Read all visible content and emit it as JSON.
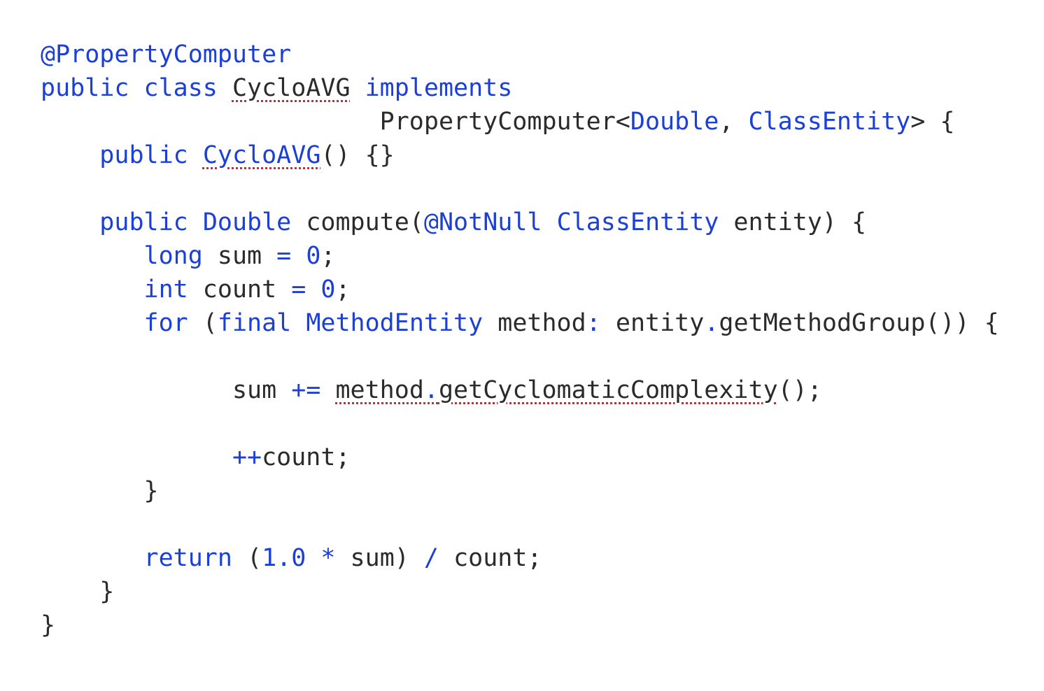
{
  "editor": {
    "colors": {
      "keyword": "#1c3fd6",
      "text": "#2b2b2b",
      "error_underline": "#e0202a",
      "background": "#ffffff"
    },
    "lines": [
      {
        "indent": 0,
        "tokens": [
          {
            "t": "@PropertyComputer",
            "c": "ann"
          }
        ]
      },
      {
        "indent": 0,
        "tokens": [
          {
            "t": "public",
            "c": "kw"
          },
          {
            "t": " ",
            "c": "plain"
          },
          {
            "t": "class",
            "c": "kw"
          },
          {
            "t": " ",
            "c": "plain"
          },
          {
            "t": "CycloAVG",
            "c": "plain",
            "err": true
          },
          {
            "t": " ",
            "c": "plain"
          },
          {
            "t": "implements",
            "c": "kw"
          }
        ]
      },
      {
        "indent": 0,
        "tokens": [
          {
            "t": "                       PropertyComputer<",
            "c": "plain"
          },
          {
            "t": "Double",
            "c": "ty"
          },
          {
            "t": ", ",
            "c": "plain"
          },
          {
            "t": "ClassEntity",
            "c": "ty"
          },
          {
            "t": "> {",
            "c": "plain"
          }
        ]
      },
      {
        "indent": 0,
        "tokens": [
          {
            "t": "    ",
            "c": "plain"
          },
          {
            "t": "public",
            "c": "kw"
          },
          {
            "t": " ",
            "c": "plain"
          },
          {
            "t": "CycloAVG",
            "c": "ty",
            "err": true
          },
          {
            "t": "() {}",
            "c": "plain"
          }
        ]
      },
      {
        "indent": 0,
        "tokens": []
      },
      {
        "indent": 0,
        "tokens": [
          {
            "t": "    ",
            "c": "plain"
          },
          {
            "t": "public",
            "c": "kw"
          },
          {
            "t": " ",
            "c": "plain"
          },
          {
            "t": "Double",
            "c": "ty"
          },
          {
            "t": " compute(",
            "c": "plain"
          },
          {
            "t": "@NotNull",
            "c": "ann"
          },
          {
            "t": " ",
            "c": "plain"
          },
          {
            "t": "ClassEntity",
            "c": "ty"
          },
          {
            "t": " entity) {",
            "c": "plain"
          }
        ]
      },
      {
        "indent": 0,
        "tokens": [
          {
            "t": "       ",
            "c": "plain"
          },
          {
            "t": "long",
            "c": "kw"
          },
          {
            "t": " sum ",
            "c": "plain"
          },
          {
            "t": "=",
            "c": "op"
          },
          {
            "t": " ",
            "c": "plain"
          },
          {
            "t": "0",
            "c": "num"
          },
          {
            "t": ";",
            "c": "plain"
          }
        ]
      },
      {
        "indent": 0,
        "tokens": [
          {
            "t": "       ",
            "c": "plain"
          },
          {
            "t": "int",
            "c": "kw"
          },
          {
            "t": " count ",
            "c": "plain"
          },
          {
            "t": "=",
            "c": "op"
          },
          {
            "t": " ",
            "c": "plain"
          },
          {
            "t": "0",
            "c": "num"
          },
          {
            "t": ";",
            "c": "plain"
          }
        ]
      },
      {
        "indent": 0,
        "tokens": [
          {
            "t": "       ",
            "c": "plain"
          },
          {
            "t": "for",
            "c": "kw"
          },
          {
            "t": " (",
            "c": "plain"
          },
          {
            "t": "final",
            "c": "kw"
          },
          {
            "t": " ",
            "c": "plain"
          },
          {
            "t": "MethodEntity",
            "c": "ty"
          },
          {
            "t": " method",
            "c": "plain"
          },
          {
            "t": ":",
            "c": "op"
          },
          {
            "t": " entity",
            "c": "plain"
          },
          {
            "t": ".",
            "c": "op"
          },
          {
            "t": "getMethodGroup()) {",
            "c": "plain"
          }
        ]
      },
      {
        "indent": 0,
        "tokens": []
      },
      {
        "indent": 0,
        "tokens": [
          {
            "t": "             ",
            "c": "plain"
          },
          {
            "t": "sum ",
            "c": "plain"
          },
          {
            "t": "+=",
            "c": "op"
          },
          {
            "t": " ",
            "c": "plain"
          },
          {
            "t": "method",
            "c": "plain",
            "err": true
          },
          {
            "t": ".",
            "c": "op",
            "err": true
          },
          {
            "t": "getCyclomaticComplexity",
            "c": "plain",
            "err": true
          },
          {
            "t": "();",
            "c": "plain"
          }
        ]
      },
      {
        "indent": 0,
        "tokens": []
      },
      {
        "indent": 0,
        "tokens": [
          {
            "t": "             ",
            "c": "plain"
          },
          {
            "t": "++",
            "c": "op"
          },
          {
            "t": "count;",
            "c": "plain"
          }
        ]
      },
      {
        "indent": 0,
        "tokens": [
          {
            "t": "       }",
            "c": "plain"
          }
        ]
      },
      {
        "indent": 0,
        "tokens": []
      },
      {
        "indent": 0,
        "tokens": [
          {
            "t": "       ",
            "c": "plain"
          },
          {
            "t": "return",
            "c": "kw"
          },
          {
            "t": " (",
            "c": "plain"
          },
          {
            "t": "1.0",
            "c": "num"
          },
          {
            "t": " ",
            "c": "plain"
          },
          {
            "t": "*",
            "c": "op"
          },
          {
            "t": " sum) ",
            "c": "plain"
          },
          {
            "t": "/",
            "c": "op"
          },
          {
            "t": " count;",
            "c": "plain"
          }
        ]
      },
      {
        "indent": 0,
        "tokens": [
          {
            "t": "    }",
            "c": "plain"
          }
        ]
      },
      {
        "indent": 0,
        "tokens": [
          {
            "t": "}",
            "c": "plain"
          }
        ]
      }
    ]
  }
}
